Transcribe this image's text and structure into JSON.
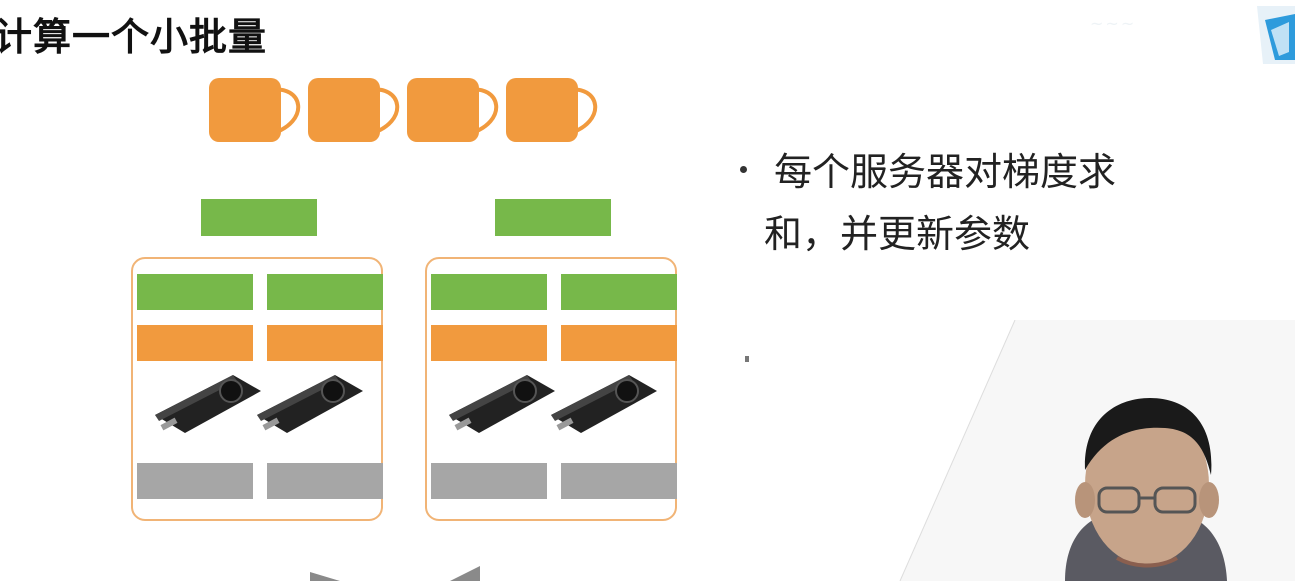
{
  "slide": {
    "title": "计算一个小批量",
    "bullet_line1": "每个服务器对梯度求",
    "bullet_line2": "和，并更新参数"
  },
  "colors": {
    "green": "#77b84a",
    "orange": "#f19a3e",
    "gray": "#a6a6a6",
    "server_border": "#f1b476"
  }
}
